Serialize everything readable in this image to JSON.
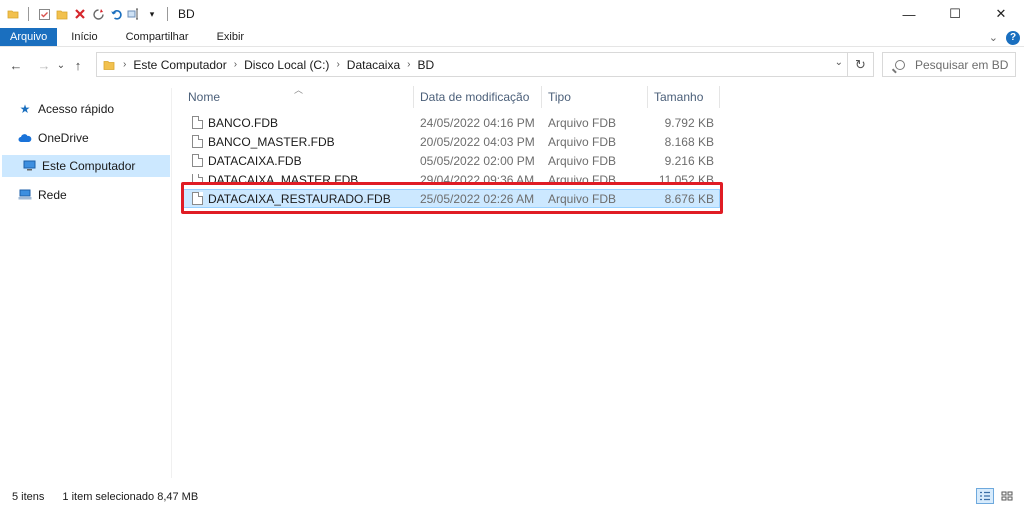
{
  "window": {
    "title": "BD",
    "controls": {
      "minimize": "—",
      "maximize": "☐",
      "close": "✕"
    }
  },
  "ribbon": {
    "tabs": [
      "Arquivo",
      "Início",
      "Compartilhar",
      "Exibir"
    ],
    "active_tab": "Arquivo",
    "help": "?"
  },
  "navigation": {
    "back": "←",
    "forward": "→",
    "recent": "⌄",
    "up": "↑",
    "breadcrumb": [
      "Este Computador",
      "Disco Local (C:)",
      "Datacaixa",
      "BD"
    ],
    "refresh": "↻",
    "search_placeholder": "Pesquisar em BD"
  },
  "sidebar": {
    "items": [
      {
        "label": "Acesso rápido",
        "icon": "star-icon",
        "selected": false
      },
      {
        "label": "OneDrive",
        "icon": "cloud-icon",
        "selected": false
      },
      {
        "label": "Este Computador",
        "icon": "computer-icon",
        "selected": true
      },
      {
        "label": "Rede",
        "icon": "network-icon",
        "selected": false
      }
    ]
  },
  "file_list": {
    "columns": [
      "Nome",
      "Data de modificação",
      "Tipo",
      "Tamanho"
    ],
    "rows": [
      {
        "name": "BANCO.FDB",
        "modified": "24/05/2022 04:16 PM",
        "type": "Arquivo FDB",
        "size": "9.792 KB"
      },
      {
        "name": "BANCO_MASTER.FDB",
        "modified": "20/05/2022 04:03 PM",
        "type": "Arquivo FDB",
        "size": "8.168 KB"
      },
      {
        "name": "DATACAIXA.FDB",
        "modified": "05/05/2022 02:00 PM",
        "type": "Arquivo FDB",
        "size": "9.216 KB"
      },
      {
        "name": "DATACAIXA_MASTER.FDB",
        "modified": "29/04/2022 09:36 AM",
        "type": "Arquivo FDB",
        "size": "11.052 KB"
      },
      {
        "name": "DATACAIXA_RESTAURADO.FDB",
        "modified": "25/05/2022 02:26 AM",
        "type": "Arquivo FDB",
        "size": "8.676 KB"
      }
    ],
    "selected_index": 4,
    "highlight_color": "#e01c24"
  },
  "status_bar": {
    "item_count": "5 itens",
    "selection": "1 item selecionado  8,47 MB"
  }
}
